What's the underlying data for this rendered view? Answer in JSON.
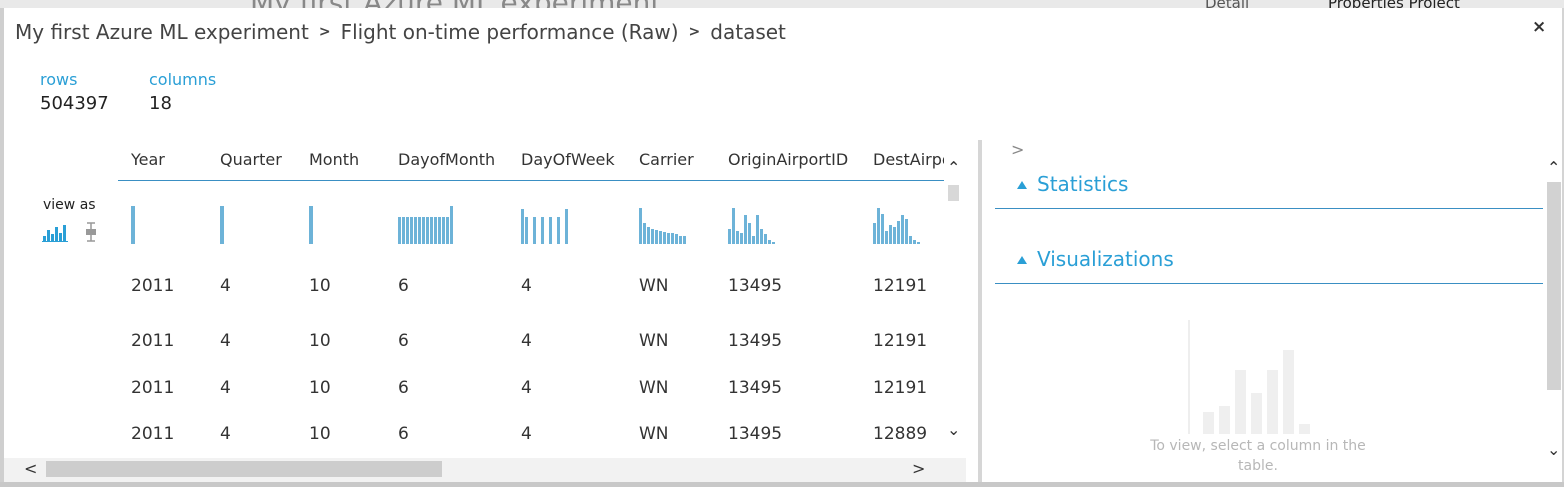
{
  "background": {
    "ghost_title": "My first Azure ML experiment",
    "ghost_tab1": "Detail",
    "ghost_tab2": "Properties   Project"
  },
  "breadcrumb": [
    "My first Azure ML experiment",
    "Flight on-time performance (Raw)",
    "dataset"
  ],
  "close_label": "×",
  "summary": {
    "rows_label": "rows",
    "rows_value": "504397",
    "columns_label": "columns",
    "columns_value": "18"
  },
  "view_as_label": "view as",
  "columns": [
    "Year",
    "Quarter",
    "Month",
    "DayofMonth",
    "DayOfWeek",
    "Carrier",
    "OriginAirportID",
    "DestAirportID"
  ],
  "histograms": [
    [
      1.0
    ],
    [
      1.0
    ],
    [
      1.0
    ],
    [
      0.72,
      0.72,
      0.72,
      0.72,
      0.72,
      0.72,
      0.72,
      0.72,
      0.72,
      0.72,
      0.72,
      0.72,
      0.72,
      1.0
    ],
    [
      0.92,
      0.72,
      0,
      0.72,
      0,
      0.72,
      0,
      0.72,
      0,
      0.72,
      0,
      0.92
    ],
    [
      0.95,
      0.55,
      0.45,
      0.4,
      0.38,
      0.35,
      0.32,
      0.3,
      0.28,
      0.25,
      0.22,
      0.2
    ],
    [
      0.4,
      0.95,
      0.35,
      0.3,
      0.75,
      0.55,
      0.2,
      0.75,
      0.4,
      0.25,
      0.1,
      0.05
    ],
    [
      0.55,
      0.95,
      0.8,
      0.35,
      0.5,
      0.45,
      0.6,
      0.75,
      0.65,
      0.2,
      0.1,
      0.05
    ]
  ],
  "rows": [
    [
      "2011",
      "4",
      "10",
      "6",
      "4",
      "WN",
      "13495",
      "12191"
    ],
    [
      "2011",
      "4",
      "10",
      "6",
      "4",
      "WN",
      "13495",
      "12191"
    ],
    [
      "2011",
      "4",
      "10",
      "6",
      "4",
      "WN",
      "13495",
      "12191"
    ],
    [
      "2011",
      "4",
      "10",
      "6",
      "4",
      "WN",
      "13495",
      "12889"
    ]
  ],
  "right_panel": {
    "statistics_title": "Statistics",
    "visualizations_title": "Visualizations",
    "placeholder_text": "To view, select a column in the table."
  },
  "colors": {
    "accent": "#2a9fd6",
    "histogram": "#6db3d8"
  }
}
